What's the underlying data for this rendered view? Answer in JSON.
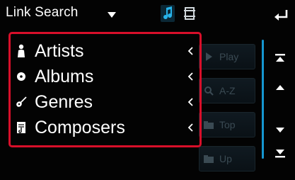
{
  "header": {
    "title": "Link Search",
    "title_dropdown_icon": "triangle-down-icon",
    "mode_music_icon": "music-note-icon",
    "mode_video_icon": "film-icon",
    "back_icon": "return-arrow-icon"
  },
  "list": {
    "items": [
      {
        "label": "Artists",
        "icon": "person-icon",
        "chevron": "‹"
      },
      {
        "label": "Albums",
        "icon": "disc-icon",
        "chevron": "‹"
      },
      {
        "label": "Genres",
        "icon": "guitar-icon",
        "chevron": "‹"
      },
      {
        "label": "Composers",
        "icon": "score-icon",
        "chevron": "‹"
      }
    ]
  },
  "side_buttons": [
    {
      "label": "Play",
      "icon": "play-icon"
    },
    {
      "label": "A-Z",
      "icon": "search-icon"
    },
    {
      "label": "Top",
      "icon": "folder-top-icon"
    },
    {
      "label": "Up",
      "icon": "folder-up-icon"
    }
  ],
  "scroll": {
    "top_icon": "scroll-to-top-icon",
    "up_icon": "scroll-up-icon",
    "down_icon": "scroll-down-icon",
    "bottom_icon": "scroll-to-bottom-icon"
  },
  "colors": {
    "highlight": "#d80f2a",
    "accent": "#1596d0",
    "text": "#ffffff",
    "disabled": "#3a4a53"
  }
}
